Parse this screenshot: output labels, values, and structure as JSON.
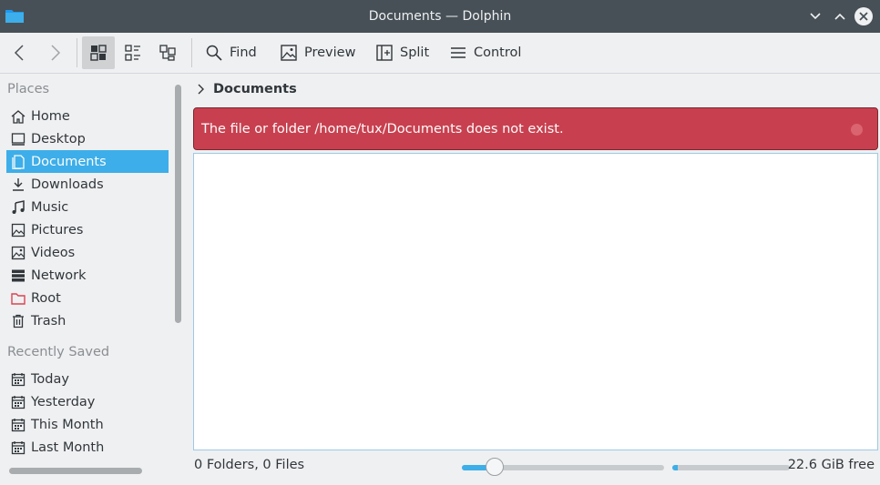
{
  "window": {
    "title": "Documents — Dolphin"
  },
  "toolbar": {
    "find": "Find",
    "preview": "Preview",
    "split": "Split",
    "control": "Control"
  },
  "sidebar": {
    "places_title": "Places",
    "places": [
      {
        "label": "Home",
        "icon": "home-icon"
      },
      {
        "label": "Desktop",
        "icon": "desktop-icon"
      },
      {
        "label": "Documents",
        "icon": "documents-icon",
        "selected": true
      },
      {
        "label": "Downloads",
        "icon": "downloads-icon"
      },
      {
        "label": "Music",
        "icon": "music-icon"
      },
      {
        "label": "Pictures",
        "icon": "pictures-icon"
      },
      {
        "label": "Videos",
        "icon": "videos-icon"
      },
      {
        "label": "Network",
        "icon": "network-icon"
      },
      {
        "label": "Root",
        "icon": "root-folder-icon"
      },
      {
        "label": "Trash",
        "icon": "trash-icon"
      }
    ],
    "recent_title": "Recently Saved",
    "recent": [
      {
        "label": "Today",
        "icon": "calendar-icon"
      },
      {
        "label": "Yesterday",
        "icon": "calendar-icon"
      },
      {
        "label": "This Month",
        "icon": "calendar-icon"
      },
      {
        "label": "Last Month",
        "icon": "calendar-icon"
      }
    ]
  },
  "breadcrumb": {
    "current": "Documents"
  },
  "error": {
    "message": "The file or folder /home/tux/Documents does not exist."
  },
  "status": {
    "summary": "0 Folders, 0 Files",
    "free_space": "22.6 GiB free",
    "zoom_level_fraction": 0.16,
    "disk_used_fraction": 0.05
  },
  "colors": {
    "accent": "#3daee9",
    "error": "#c8404f",
    "titlebar": "#475057"
  }
}
